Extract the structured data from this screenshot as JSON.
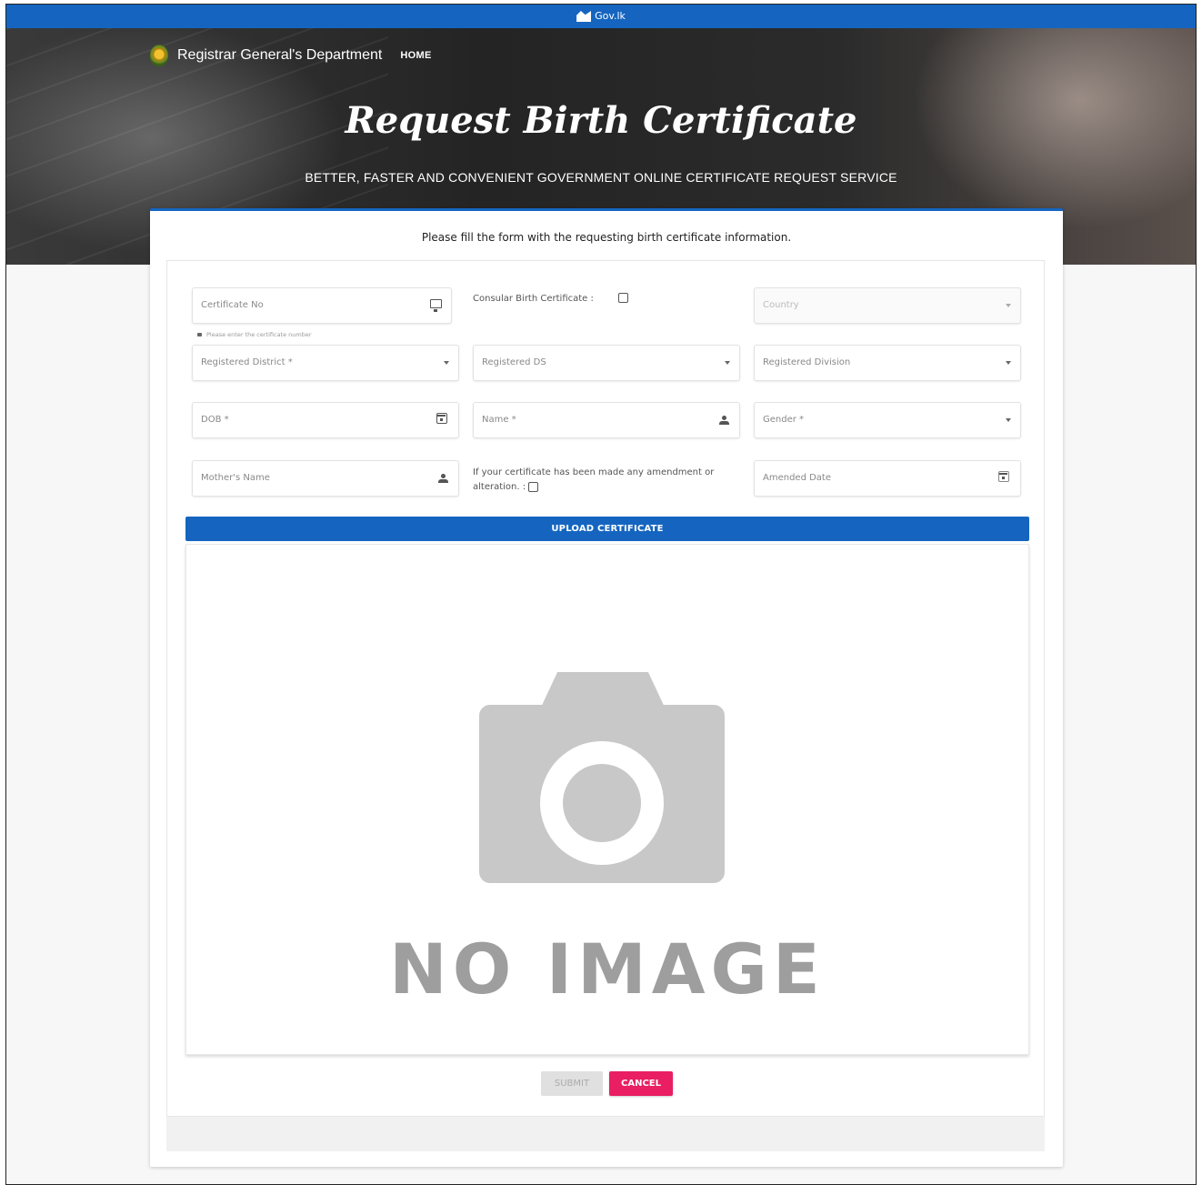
{
  "topbar": {
    "gov_label": "Gov.lk"
  },
  "header": {
    "brand": "Registrar General's Department",
    "nav_home": "HOME"
  },
  "hero": {
    "title": "Request Birth Certificate",
    "subtitle": "BETTER, FASTER AND CONVENIENT GOVERNMENT ONLINE CERTIFICATE REQUEST SERVICE"
  },
  "form": {
    "intro": "Please fill the form with the requesting birth certificate information.",
    "certificate_no": {
      "placeholder": "Certificate No",
      "hint": "Please enter the certificate number",
      "icon": "monitor-icon"
    },
    "consular": {
      "label": "Consular Birth Certificate :",
      "checked": false
    },
    "country": {
      "placeholder": "Country",
      "disabled": true
    },
    "registered_district": {
      "placeholder": "Registered District *"
    },
    "registered_ds": {
      "placeholder": "Registered DS"
    },
    "registered_division": {
      "placeholder": "Registered Division"
    },
    "dob": {
      "placeholder": "DOB *",
      "icon": "calendar-icon"
    },
    "name": {
      "placeholder": "Name *",
      "icon": "person-icon"
    },
    "gender": {
      "placeholder": "Gender *"
    },
    "mothers_name": {
      "placeholder": "Mother's Name",
      "icon": "person-icon"
    },
    "amendment": {
      "label_line1": "If your certificate has been made any amendment or",
      "label_line2": "alteration. :",
      "checked": false
    },
    "amended_date": {
      "placeholder": "Amended Date",
      "icon": "calendar-icon"
    }
  },
  "upload": {
    "button_label": "UPLOAD CERTIFICATE",
    "preview_text": "NO IMAGE"
  },
  "actions": {
    "submit_label": "SUBMIT",
    "cancel_label": "CANCEL"
  },
  "colors": {
    "primary": "#1565c0",
    "cancel": "#e91e63",
    "disabled": "#e0e0e0"
  }
}
